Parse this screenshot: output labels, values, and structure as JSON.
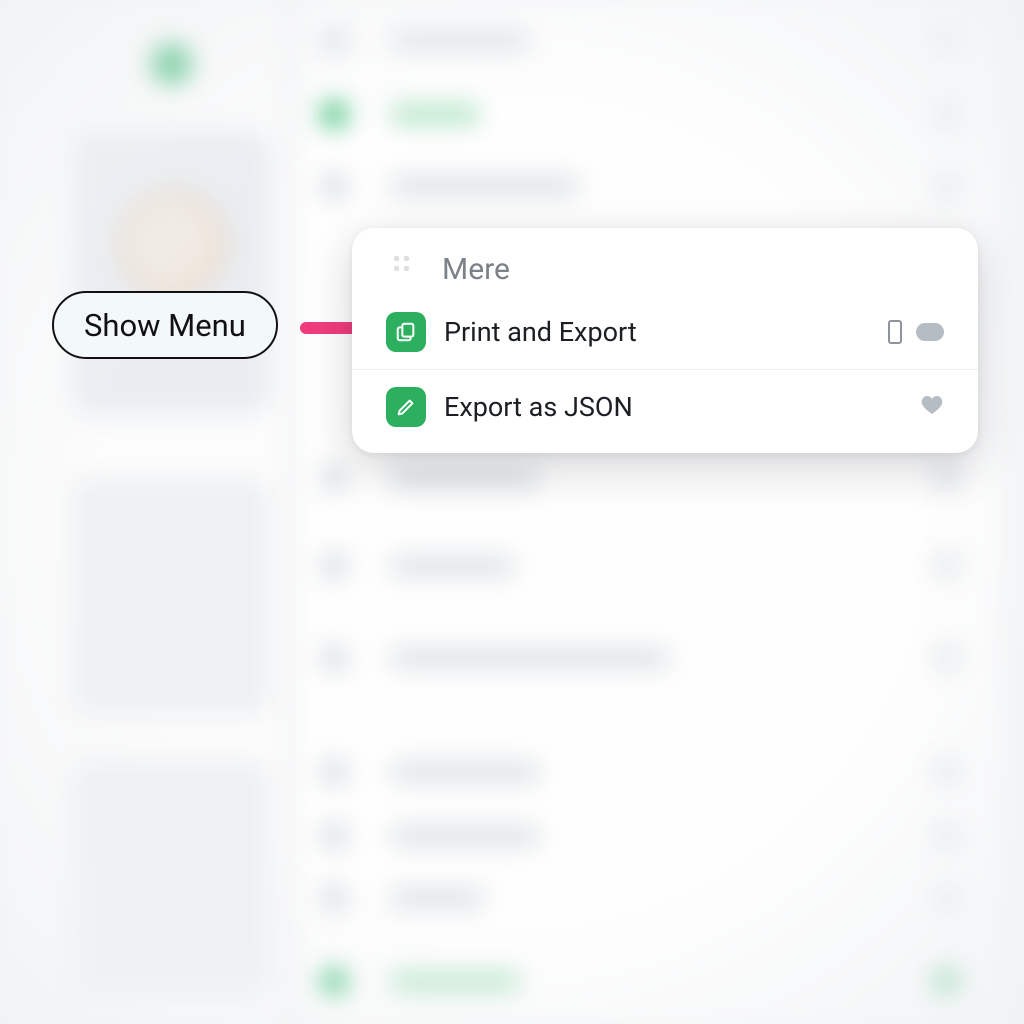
{
  "callout": {
    "label": "Show Menu"
  },
  "menu": {
    "header": "Mere",
    "items": [
      {
        "label": "Print and Export"
      },
      {
        "label": "Export as JSON"
      }
    ]
  }
}
